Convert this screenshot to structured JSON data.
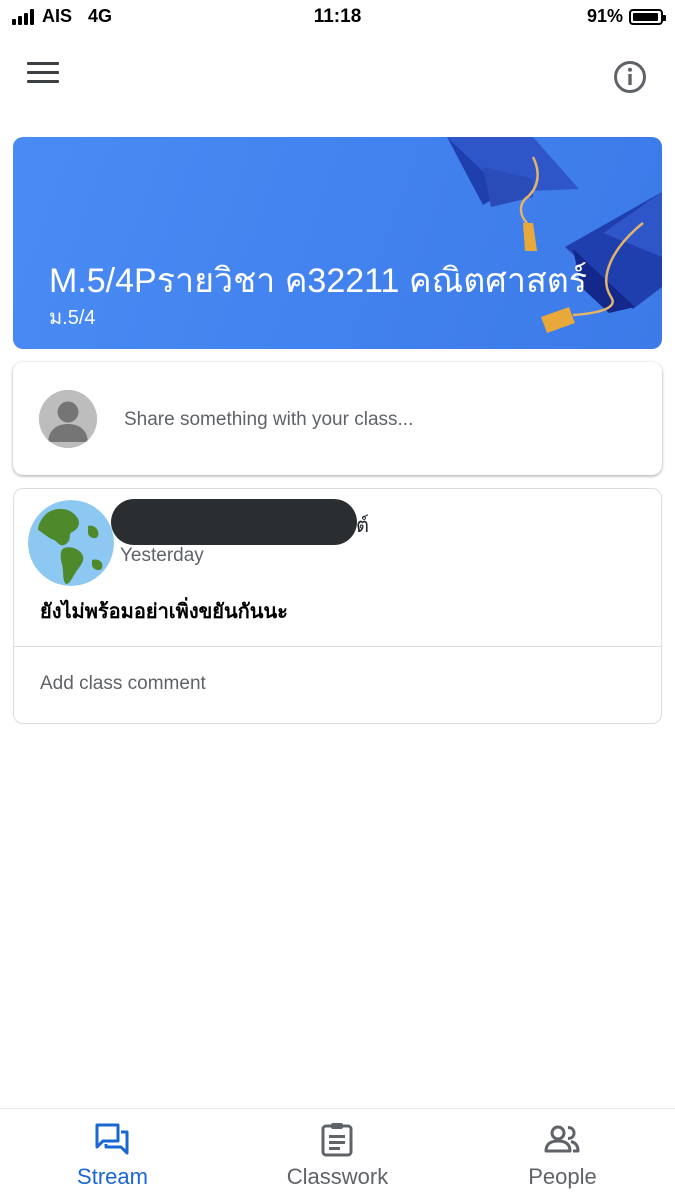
{
  "status_bar": {
    "carrier": "AIS",
    "network": "4G",
    "time": "11:18",
    "battery": "91%",
    "battery_level": 0.91
  },
  "app_bar": {
    "menu_icon": "menu-icon",
    "info_icon": "info-icon"
  },
  "banner": {
    "title": "M.5/4Pรายวิชา ค32211 คณิตศาสตร์",
    "subtitle": "ม.5/4",
    "color": "#4285f4",
    "art": "graduation-caps-illustration"
  },
  "share": {
    "placeholder": "Share something with your class..."
  },
  "post": {
    "author_suffix": "ต์",
    "time": "Yesterday",
    "body": "ยังไม่พร้อมอย่าเพิ่งขยันกันนะ",
    "comment_label": "Add class comment"
  },
  "bottom_nav": {
    "items": [
      {
        "label": "Stream",
        "icon": "stream-icon",
        "active": true
      },
      {
        "label": "Classwork",
        "icon": "classwork-icon",
        "active": false
      },
      {
        "label": "People",
        "icon": "people-icon",
        "active": false
      }
    ],
    "active_color": "#1967d2",
    "inactive_color": "#5f6368"
  }
}
